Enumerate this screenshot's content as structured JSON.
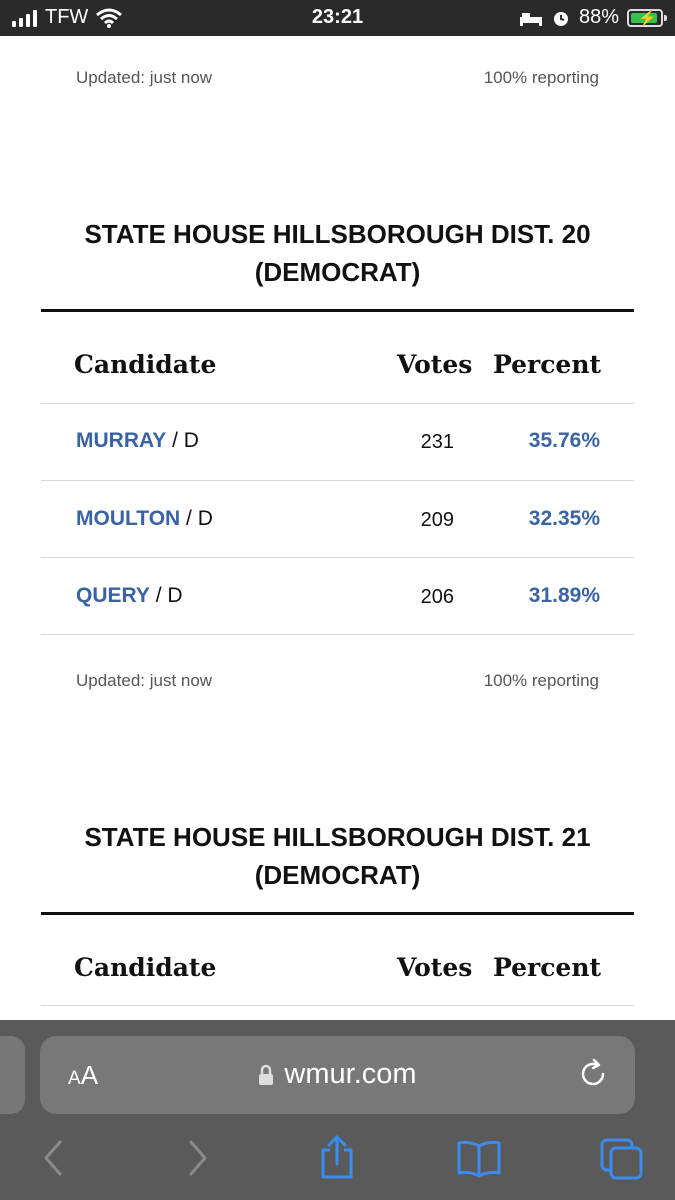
{
  "status_bar": {
    "carrier": "TFW",
    "time": "23:21",
    "battery": "88%"
  },
  "races": [
    {
      "updated": "Updated: just now",
      "reporting": "100% reporting"
    },
    {
      "title_line1": "STATE HOUSE HILLSBOROUGH DIST. 20",
      "title_line2": "(DEMOCRAT)",
      "col_candidate": "Candidate",
      "col_votes": "Votes",
      "col_percent": "Percent",
      "candidates": [
        {
          "name": "MURRAY",
          "party": " / D",
          "votes": "231",
          "percent": "35.76%"
        },
        {
          "name": "MOULTON",
          "party": " / D",
          "votes": "209",
          "percent": "32.35%"
        },
        {
          "name": "QUERY",
          "party": " / D",
          "votes": "206",
          "percent": "31.89%"
        }
      ],
      "updated": "Updated: just now",
      "reporting": "100% reporting"
    },
    {
      "title_line1": "STATE HOUSE HILLSBOROUGH DIST. 21",
      "title_line2": "(DEMOCRAT)",
      "col_candidate": "Candidate",
      "col_votes": "Votes",
      "col_percent": "Percent"
    }
  ],
  "browser": {
    "text_size_label_small": "A",
    "text_size_label_large": "A",
    "url": "wmur.com",
    "icons": [
      "back-icon",
      "forward-icon",
      "share-icon",
      "bookmarks-icon",
      "tabs-icon",
      "reload-icon",
      "lock-icon"
    ]
  }
}
